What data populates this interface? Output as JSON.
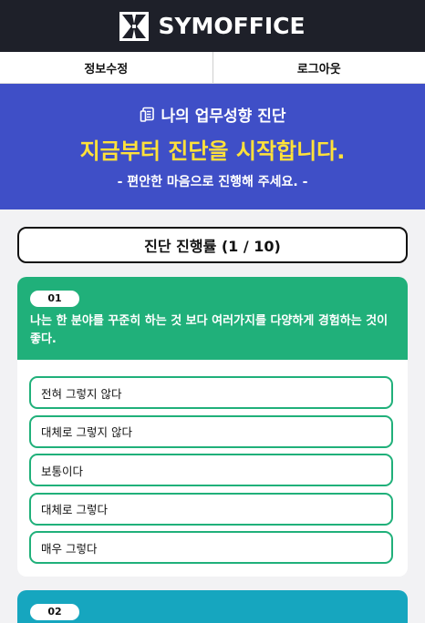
{
  "header": {
    "brand": "SYMOFFICE",
    "logo_icon": "symoffice-logo-icon"
  },
  "nav": {
    "edit_profile": "정보수정",
    "logout": "로그아웃"
  },
  "hero": {
    "title": "나의 업무성향 진단",
    "title_icon": "document-icon",
    "headline": "지금부터 진단을 시작합니다.",
    "subtitle": "- 편안한 마음으로 진행해 주세요. -"
  },
  "progress": {
    "label": "진단 진행률 (1 / 10)"
  },
  "questions": [
    {
      "number": "01",
      "text": "나는 한 분야를 꾸준히 하는 것 보다 여러가지를 다양하게 경험하는 것이 좋다.",
      "options": [
        "전혀 그렇지 않다",
        "대체로 그렇지 않다",
        "보통이다",
        "대체로 그렇다",
        "매우 그렇다"
      ]
    },
    {
      "number": "02"
    }
  ],
  "colors": {
    "topbar": "#1e2029",
    "hero": "#3f4fc7",
    "headline": "#ffe13a",
    "question_green": "#20b07a",
    "question_teal": "#16a6bf"
  }
}
